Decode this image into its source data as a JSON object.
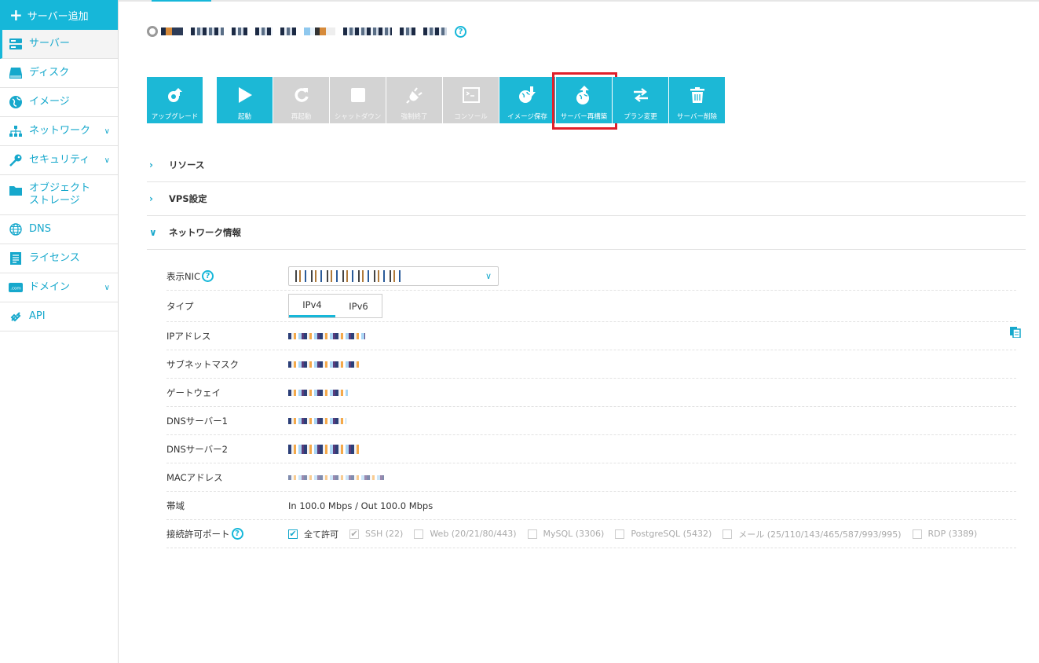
{
  "sidebar": {
    "add_label": "サーバー追加",
    "items": [
      {
        "label": "サーバー",
        "icon": "server-icon",
        "active": true
      },
      {
        "label": "ディスク",
        "icon": "disk-icon"
      },
      {
        "label": "イメージ",
        "icon": "globe-image-icon"
      },
      {
        "label": "ネットワーク",
        "icon": "network-icon",
        "expand": true
      },
      {
        "label": "セキュリティ",
        "icon": "key-icon",
        "expand": true
      },
      {
        "label": "オブジェクト\nストレージ",
        "icon": "folder-icon"
      },
      {
        "label": "DNS",
        "icon": "dns-globe-icon"
      },
      {
        "label": "ライセンス",
        "icon": "license-icon"
      },
      {
        "label": "ドメイン",
        "icon": "domain-icon",
        "expand": true
      },
      {
        "label": "API",
        "icon": "api-icon"
      }
    ]
  },
  "toolbar": {
    "upgrade": "アップグレード",
    "start": "起動",
    "restart": "再起動",
    "shutdown": "シャットダウン",
    "force_stop": "強制終了",
    "console": "コンソール",
    "save_image": "イメージ保存",
    "rebuild": "サーバー再構築",
    "change_plan": "プラン変更",
    "delete_server": "サーバー削除"
  },
  "sections": {
    "resource": "リソース",
    "vps": "VPS設定",
    "network": "ネットワーク情報"
  },
  "network": {
    "nic_label": "表示NIC",
    "type_label": "タイプ",
    "tab_ipv4": "IPv4",
    "tab_ipv6": "IPv6",
    "ip_label": "IPアドレス",
    "subnet_label": "サブネットマスク",
    "gateway_label": "ゲートウェイ",
    "dns1_label": "DNSサーバー1",
    "dns2_label": "DNSサーバー2",
    "mac_label": "MACアドレス",
    "bandwidth_label": "帯域",
    "bandwidth_value": "In 100.0 Mbps / Out 100.0 Mbps",
    "ports_label": "接続許可ポート",
    "ports": [
      {
        "label": "全て許可",
        "checked": true,
        "enabled": true
      },
      {
        "label": "SSH (22)",
        "checked": true,
        "enabled": false
      },
      {
        "label": "Web (20/21/80/443)",
        "checked": false,
        "enabled": false
      },
      {
        "label": "MySQL (3306)",
        "checked": false,
        "enabled": false
      },
      {
        "label": "PostgreSQL (5432)",
        "checked": false,
        "enabled": false
      },
      {
        "label": "メール (25/110/143/465/587/993/995)",
        "checked": false,
        "enabled": false
      },
      {
        "label": "RDP (3389)",
        "checked": false,
        "enabled": false
      }
    ]
  },
  "colors": {
    "accent": "#16b7d9",
    "highlight": "#e0202b",
    "disabled": "#d3d3d3"
  }
}
